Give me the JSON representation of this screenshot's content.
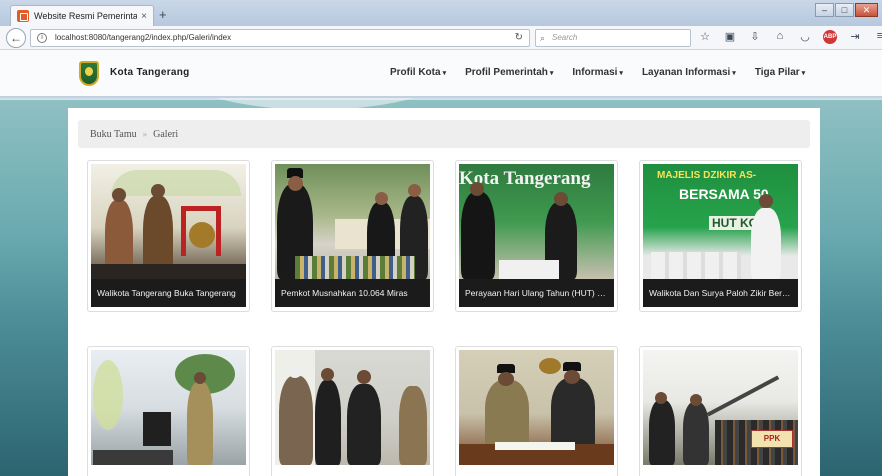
{
  "browser": {
    "tab_title": "Website Resmi Pemerintah K",
    "tab_close": "×",
    "new_tab": "+",
    "url": "localhost:8080/tangerang2/index.php/Galeri/index",
    "search_placeholder": "Search",
    "icons": [
      "star-icon",
      "clipboard-icon",
      "download-icon",
      "home-icon",
      "pocket-icon",
      "ublock-icon",
      "forward-icon",
      "menu-icon"
    ]
  },
  "site": {
    "name": "Kota Tangerang",
    "nav": [
      {
        "label": "Profil Kota"
      },
      {
        "label": "Profil Pemerintah"
      },
      {
        "label": "Informasi"
      },
      {
        "label": "Layanan Informasi"
      },
      {
        "label": "Tiga Pilar"
      }
    ]
  },
  "breadcrumb": {
    "items": [
      "Buku Tamu",
      "Galeri"
    ],
    "separator": "»"
  },
  "gallery": [
    {
      "caption": "Walikota Tangerang Buka Tangerang"
    },
    {
      "caption": "Pemkot Musnahkan 10.064 Miras"
    },
    {
      "caption": "Perayaan Hari Ulang Tahun (HUT) Kota Tangerang"
    },
    {
      "caption": "Walikota Dan Surya Paloh Zikir Bersama"
    },
    {
      "caption": ""
    },
    {
      "caption": ""
    },
    {
      "caption": ""
    },
    {
      "caption": ""
    }
  ],
  "photo_text": {
    "banner_kota": "Kota Tangerang",
    "banner_majelis": "MAJELIS DZIKIR AS-",
    "banner_bersama": "BERSAMA 50",
    "banner_hut": "HUT KO",
    "sign_ppk": "PPK"
  },
  "colors": {
    "caption_bg": "#1b1b1b",
    "breadcrumb_bg": "#eeeeee",
    "accent_header_border": "#c4cfe0"
  }
}
